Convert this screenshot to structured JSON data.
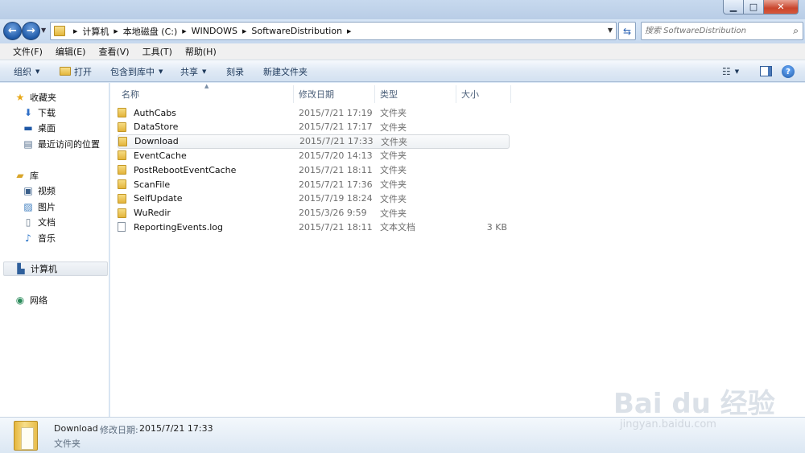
{
  "window": {
    "min_icon": "minimize-icon",
    "max_icon": "maximize-icon",
    "close_icon": "close-icon"
  },
  "nav": {
    "back_icon": "back-arrow-icon",
    "forward_icon": "forward-arrow-icon",
    "breadcrumbs": [
      "计算机",
      "本地磁盘 (C:)",
      "WINDOWS",
      "SoftwareDistribution"
    ],
    "search_placeholder": "搜索 SoftwareDistribution"
  },
  "menu": [
    "文件(F)",
    "编辑(E)",
    "查看(V)",
    "工具(T)",
    "帮助(H)"
  ],
  "toolbar": {
    "organize": "组织",
    "open": "打开",
    "include_library": "包含到库中",
    "share": "共享",
    "burn": "刻录",
    "new_folder": "新建文件夹"
  },
  "sidebar": {
    "favorites": "收藏夹",
    "favorites_items": [
      "下载",
      "桌面",
      "最近访问的位置"
    ],
    "libraries": "库",
    "library_items": [
      "视频",
      "图片",
      "文档",
      "音乐"
    ],
    "computer": "计算机",
    "network": "网络"
  },
  "columns": {
    "name": "名称",
    "date": "修改日期",
    "type": "类型",
    "size": "大小"
  },
  "files": [
    {
      "name": "AuthCabs",
      "date": "2015/7/21 17:19",
      "type": "文件夹",
      "size": "",
      "kind": "folder"
    },
    {
      "name": "DataStore",
      "date": "2015/7/21 17:17",
      "type": "文件夹",
      "size": "",
      "kind": "folder"
    },
    {
      "name": "Download",
      "date": "2015/7/21 17:33",
      "type": "文件夹",
      "size": "",
      "kind": "folder",
      "selected": true
    },
    {
      "name": "EventCache",
      "date": "2015/7/20 14:13",
      "type": "文件夹",
      "size": "",
      "kind": "folder"
    },
    {
      "name": "PostRebootEventCache",
      "date": "2015/7/21 18:11",
      "type": "文件夹",
      "size": "",
      "kind": "folder"
    },
    {
      "name": "ScanFile",
      "date": "2015/7/21 17:36",
      "type": "文件夹",
      "size": "",
      "kind": "folder"
    },
    {
      "name": "SelfUpdate",
      "date": "2015/7/19 18:24",
      "type": "文件夹",
      "size": "",
      "kind": "folder"
    },
    {
      "name": "WuRedir",
      "date": "2015/3/26 9:59",
      "type": "文件夹",
      "size": "",
      "kind": "folder"
    },
    {
      "name": "ReportingEvents.log",
      "date": "2015/7/21 18:11",
      "type": "文本文档",
      "size": "3 KB",
      "kind": "file"
    }
  ],
  "status": {
    "name": "Download",
    "date_label": "修改日期:",
    "date": "2015/7/21 17:33",
    "type": "文件夹"
  },
  "watermark": {
    "logo": "Bai du 经验",
    "url": "jingyan.baidu.com"
  }
}
